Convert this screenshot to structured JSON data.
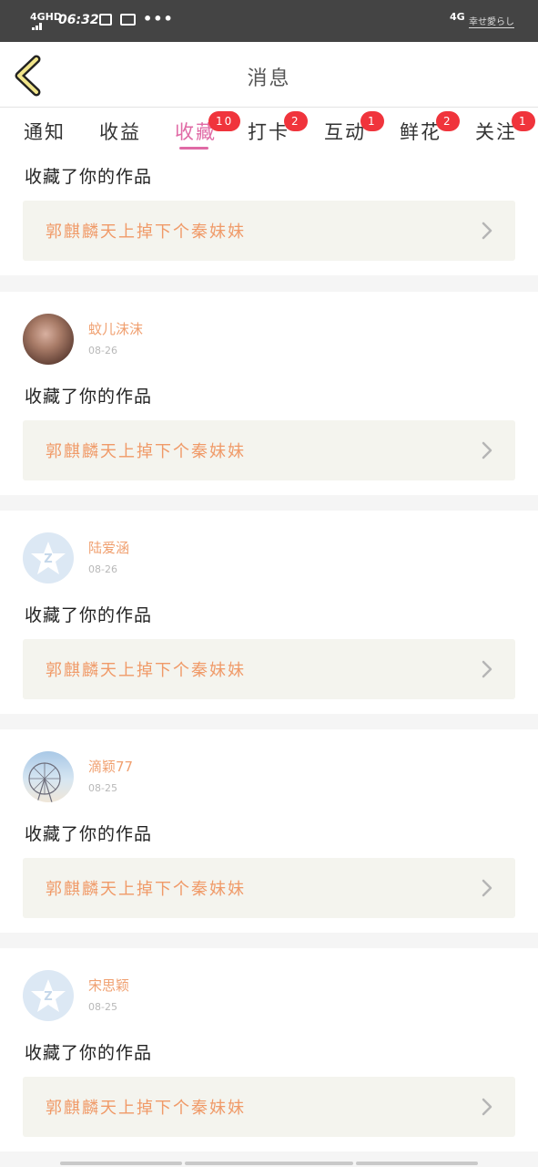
{
  "status_bar": {
    "network": "4GHD",
    "time": "06:32",
    "more": "•••",
    "right_network": "4G",
    "carrier": "幸せ愛らし"
  },
  "nav": {
    "title": "消息",
    "back_icon": "chevron-left-icon"
  },
  "tabs": [
    {
      "label": "通知",
      "badge": ""
    },
    {
      "label": "收益",
      "badge": ""
    },
    {
      "label": "收藏",
      "badge": "10",
      "active": true
    },
    {
      "label": "打卡",
      "badge": "2"
    },
    {
      "label": "互动",
      "badge": "1"
    },
    {
      "label": "鲜花",
      "badge": "2"
    },
    {
      "label": "关注",
      "badge": "1"
    }
  ],
  "colors": {
    "accent": "#e06aa5",
    "badge": "#f0343c",
    "username": "#f0a070",
    "work_title": "#f09a68"
  },
  "items": [
    {
      "action": "收藏了你的作品",
      "work": "郭麒麟天上掉下个秦妹妹"
    },
    {
      "user": "蚊儿沫沫",
      "date": "08-26",
      "avatar": "photo-avatar",
      "action": "收藏了你的作品",
      "work": "郭麒麟天上掉下个秦妹妹"
    },
    {
      "user": "陆爱涵",
      "date": "08-26",
      "avatar": "default-avatar-icon",
      "action": "收藏了你的作品",
      "work": "郭麒麟天上掉下个秦妹妹"
    },
    {
      "user": "滴颖77",
      "date": "08-25",
      "avatar": "ferris-wheel-avatar",
      "action": "收藏了你的作品",
      "work": "郭麒麟天上掉下个秦妹妹"
    },
    {
      "user": "宋思颖",
      "date": "08-25",
      "avatar": "default-avatar-icon",
      "action": "收藏了你的作品",
      "work": "郭麒麟天上掉下个秦妹妹"
    }
  ]
}
